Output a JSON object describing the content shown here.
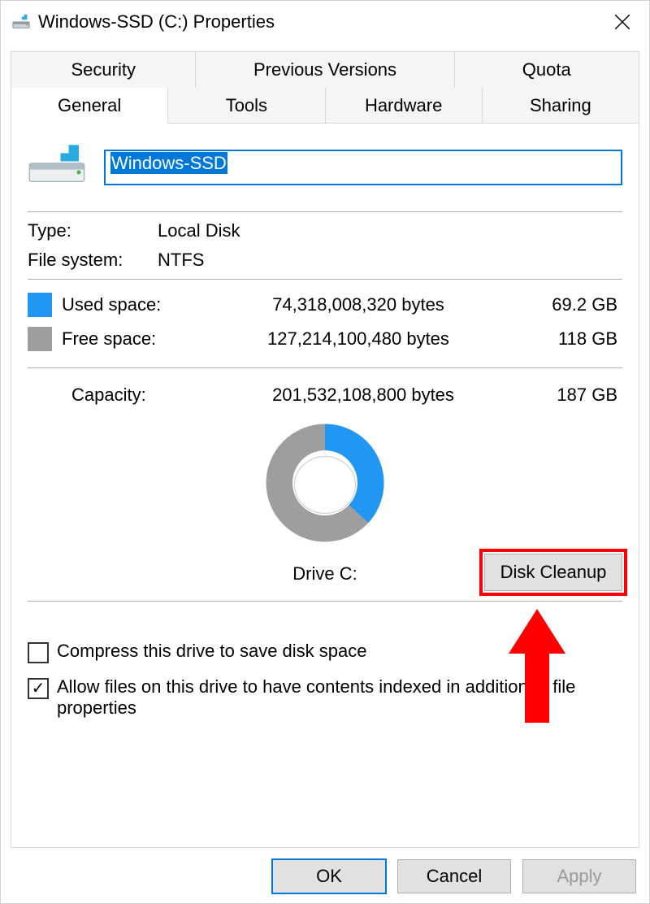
{
  "title": "Windows-SSD (C:) Properties",
  "tabs_row1": [
    "Security",
    "Previous Versions",
    "Quota"
  ],
  "tabs_row2": [
    "General",
    "Tools",
    "Hardware",
    "Sharing"
  ],
  "active_tab": "General",
  "drive_name": "Windows-SSD",
  "type": {
    "label": "Type:",
    "value": "Local Disk"
  },
  "fs": {
    "label": "File system:",
    "value": "NTFS"
  },
  "used": {
    "label": "Used space:",
    "bytes": "74,318,008,320 bytes",
    "human": "69.2 GB",
    "color": "#2196f3"
  },
  "free": {
    "label": "Free space:",
    "bytes": "127,214,100,480 bytes",
    "human": "118 GB",
    "color": "#9e9e9e"
  },
  "capacity": {
    "label": "Capacity:",
    "bytes": "201,532,108,800 bytes",
    "human": "187 GB"
  },
  "drive_chart_label": "Drive C:",
  "cleanup_label": "Disk Cleanup",
  "compress": {
    "checked": false,
    "label": "Compress this drive to save disk space"
  },
  "index": {
    "checked": true,
    "label": "Allow files on this drive to have contents indexed in addition to file properties"
  },
  "buttons": {
    "ok": "OK",
    "cancel": "Cancel",
    "apply": "Apply"
  },
  "chart_data": {
    "type": "pie",
    "title": "Drive C:",
    "series": [
      {
        "name": "Used space",
        "value": 74318008320,
        "color": "#2196f3"
      },
      {
        "name": "Free space",
        "value": 127214100480,
        "color": "#9e9e9e"
      }
    ],
    "total": 201532108800
  }
}
